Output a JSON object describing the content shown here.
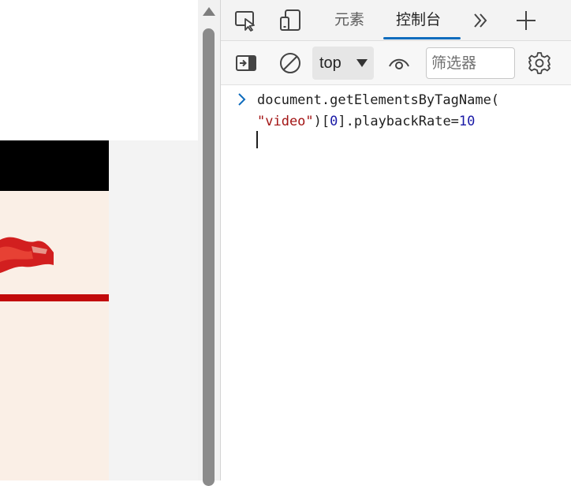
{
  "devtools": {
    "tabs": {
      "elements_label": "元素",
      "console_label": "控制台"
    },
    "toolbar": {
      "context_value": "top",
      "filter_placeholder": "筛选器"
    },
    "console": {
      "line1": "document.getElementsByTagName(",
      "line2_string": "\"video\"",
      "line2_open": ")[",
      "line2_index": "0",
      "line2_mid": "].playbackRate=",
      "line2_value": "10"
    },
    "icons": [
      "inspect-element-icon",
      "device-emulation-icon",
      "more-tabs-icon",
      "add-tab-icon",
      "sidebar-toggle-icon",
      "clear-console-icon",
      "live-expression-eye-icon",
      "settings-gear-icon",
      "prompt-chevron-icon",
      "scroll-up-arrow-icon"
    ]
  },
  "colors": {
    "accent": "#0f6cbd",
    "string": "#a31515",
    "number": "#1a1aa6",
    "banner_red": "#c20a0a"
  }
}
